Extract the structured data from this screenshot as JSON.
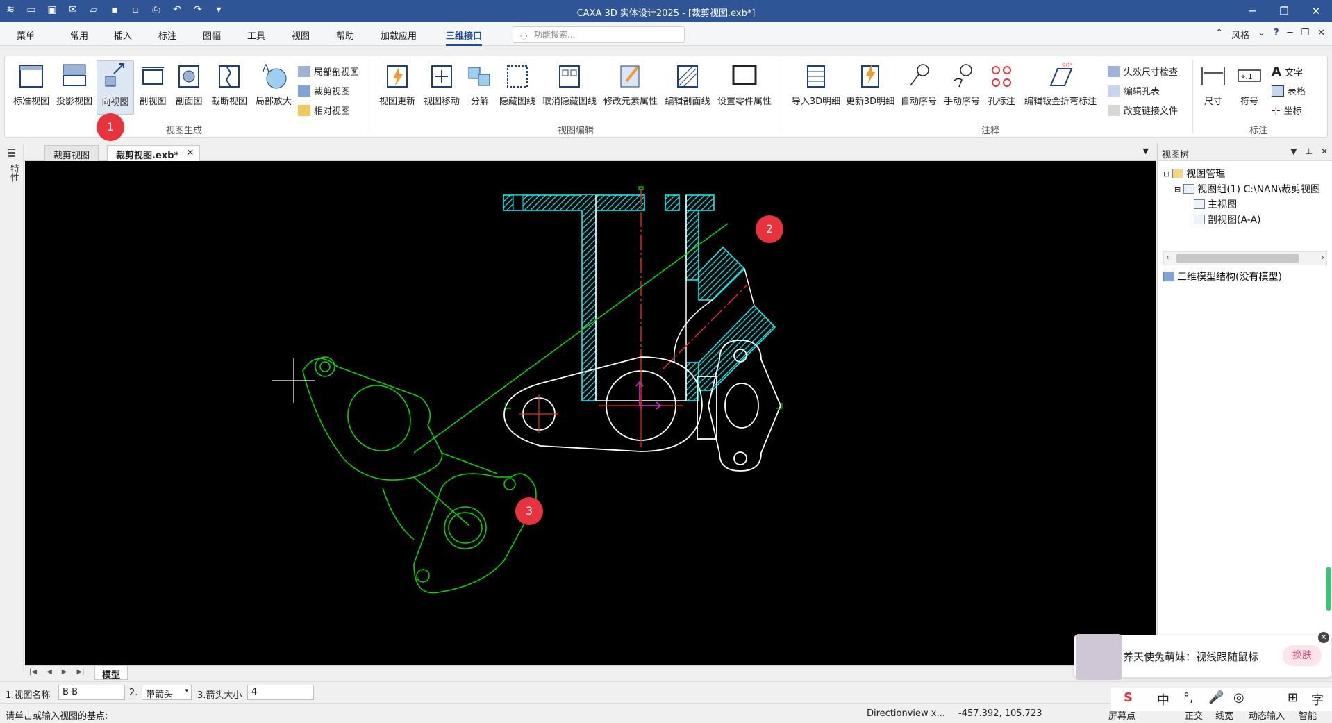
{
  "window": {
    "title": "CAXA 3D 实体设计2025 - [裁剪视图.exb*]"
  },
  "menu": {
    "tabs": [
      "菜单",
      "常用",
      "插入",
      "标注",
      "图幅",
      "工具",
      "视图",
      "帮助",
      "加载应用",
      "三维接口"
    ],
    "active_tab": "三维接口",
    "search_placeholder": "功能搜索...",
    "style_label": "风格"
  },
  "ribbon": {
    "groups": {
      "view_gen": "视图生成",
      "view_edit": "视图编辑",
      "annotation": "注释",
      "dimension": "标注"
    },
    "buttons": {
      "std_view": "标准视图",
      "proj_view": "投影视图",
      "dir_view": "向视图",
      "section_view": "剖视图",
      "cut_view": "剖面图",
      "broken_view": "截断视图",
      "detail_view": "局部放大",
      "local_section": "局部剖视图",
      "crop_view": "裁剪视图",
      "rel_view": "相对视图",
      "view_update": "视图更新",
      "view_move": "视图移动",
      "explode": "分解",
      "hide_lines": "隐藏图线",
      "unhide_lines": "取消隐藏图线",
      "modify_elem": "修改元素属性",
      "edit_hatch": "编辑剖面线",
      "part_props": "设置零件属性",
      "import_3d_bom": "导入3D明细",
      "update_3d_bom": "更新3D明细",
      "auto_seq": "自动序号",
      "manual_seq": "手动序号",
      "hole_note": "孔标注",
      "sheet_fold": "编辑钣金折弯标注",
      "invalid_dim": "失效尺寸检查",
      "edit_hole_table": "编辑孔表",
      "change_link": "改变链接文件",
      "dimension": "尺寸",
      "symbol": "符号",
      "text": "文字",
      "table": "表格",
      "coord": "坐标"
    }
  },
  "badges": [
    "1",
    "2",
    "3"
  ],
  "left_strip": {
    "label": "特性"
  },
  "doc_tabs": [
    "裁剪视图",
    "裁剪视图.exb*"
  ],
  "view_tree": {
    "title": "视图树",
    "root": "视图管理",
    "group": "视图组(1)  C:\\NAN\\裁剪视图",
    "main_view": "主视图",
    "section_view": "剖视图(A-A)",
    "model_struct": "三维模型结构(没有模型)"
  },
  "sheet_tab": "模型",
  "props": {
    "view_name_label": "1.视图名称",
    "view_name_value": "B-B",
    "arrow_label": "2.",
    "arrow_value": "带箭头",
    "arrow_size_label": "3.箭头大小",
    "arrow_size_value": "4"
  },
  "status": {
    "prompt": "请单击或输入视图的基点:",
    "command": "Directionview x...",
    "coords": "-457.392, 105.723",
    "screen_point": "屏幕点",
    "ortho": "正交",
    "linewidth": "线宽",
    "dynamic_input": "动态输入",
    "smart": "智能"
  },
  "ime": {
    "message": "养天使兔萌妹：视线跟随鼠标",
    "button": "换肤",
    "bar_items": [
      "中",
      "°,",
      "🎤",
      "◎",
      "⊞",
      "字"
    ]
  },
  "colors": {
    "titlebar": "#2f5597",
    "accent": "#1a4d9a",
    "badge": "#e8323c",
    "hatch": "#00ffff",
    "centerline": "#ff0000",
    "preview": "#00ff00"
  }
}
